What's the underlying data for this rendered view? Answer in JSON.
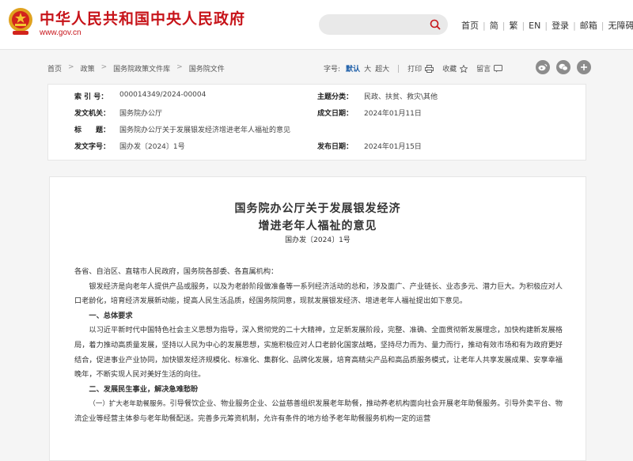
{
  "header": {
    "site_title": "中华人民共和国中央人民政府",
    "site_url": "www.gov.cn",
    "search_placeholder": "",
    "nav": [
      "首页",
      "简",
      "繁",
      "EN",
      "登录",
      "邮箱",
      "无障碍"
    ]
  },
  "breadcrumb": [
    "首页",
    "政策",
    "国务院政策文件库",
    "国务院文件"
  ],
  "tools": {
    "font_size_label": "字号:",
    "sizes": [
      "默认",
      "大",
      "超大"
    ],
    "active_size": "默认",
    "print": "打印",
    "favorite": "收藏",
    "comment": "留言"
  },
  "share_icons": [
    "weibo-icon",
    "wechat-icon",
    "more-icon"
  ],
  "meta": {
    "index_no_label": "索 引 号：",
    "index_no": "000014349/2024-00004",
    "category_label": "主题分类：",
    "category": "民政、扶贫、救灾\\其他",
    "issuer_label": "发文机关：",
    "issuer": "国务院办公厅",
    "written_date_label": "成文日期：",
    "written_date": "2024年01月11日",
    "title_label": "标　　题：",
    "title": "国务院办公厅关于发展银发经济增进老年人福祉的意见",
    "doc_no_label": "发文字号：",
    "doc_no": "国办发〔2024〕1号",
    "publish_date_label": "发布日期：",
    "publish_date": "2024年01月15日"
  },
  "article": {
    "title_line1": "国务院办公厅关于发展银发经济",
    "title_line2": "增进老年人福祉的意见",
    "doc_no": "国办发〔2024〕1号",
    "salutation": "各省、自治区、直辖市人民政府，国务院各部委、各直属机构：",
    "para1": "银发经济是向老年人提供产品或服务，以及为老龄阶段做准备等一系列经济活动的总和，涉及面广、产业链长、业态多元、潜力巨大。为积极应对人口老龄化，培育经济发展新动能，提高人民生活品质，经国务院同意，现就发展银发经济、增进老年人福祉提出如下意见。",
    "heading1": "一、总体要求",
    "para2": "以习近平新时代中国特色社会主义思想为指导，深入贯彻党的二十大精神，立足新发展阶段，完整、准确、全面贯彻新发展理念，加快构建新发展格局，着力推动高质量发展，坚持以人民为中心的发展思想，实施积极应对人口老龄化国家战略，坚持尽力而为、量力而行，推动有效市场和有为政府更好结合，促进事业产业协同，加快银发经济规模化、标准化、集群化、品牌化发展，培育高精尖产品和高品质服务模式，让老年人共享发展成果、安享幸福晚年，不断实现人民对美好生活的向往。",
    "heading2": "二、发展民生事业，解决急难愁盼",
    "sub1": "（一）扩大老年助餐服务。",
    "para3": "引导餐饮企业、物业服务企业、公益慈善组织发展老年助餐，推动养老机构面向社会开展老年助餐服务。引导外卖平台、物流企业等经营主体参与老年助餐配送。完善多元筹资机制，允许有条件的地方给予老年助餐服务机构一定的运营"
  },
  "colors": {
    "brand_red": "#c7141a",
    "link_blue": "#1c5ea8"
  }
}
